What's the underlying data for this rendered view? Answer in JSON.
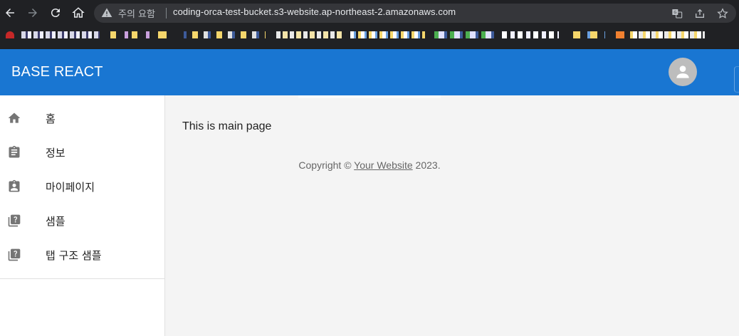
{
  "browser": {
    "security_label": "주의 요함",
    "url": "coding-orca-test-bucket.s3-website.ap-northeast-2.amazonaws.com",
    "icons": [
      "back-icon",
      "forward-icon",
      "reload-icon",
      "home-icon",
      "warning-icon",
      "translate-icon",
      "share-icon",
      "bookmark-star-icon"
    ]
  },
  "bookmarks_bar": {
    "note": ""
  },
  "appbar": {
    "title": "BASE REACT",
    "avatar_icon": "person-icon",
    "color": "#1976d2"
  },
  "drawer": {
    "items": [
      {
        "label": "홈",
        "icon": "home-icon"
      },
      {
        "label": "정보",
        "icon": "clipboard-icon"
      },
      {
        "label": "마이페이지",
        "icon": "assignment-ind-icon"
      },
      {
        "label": "샘플",
        "icon": "help-library-icon"
      },
      {
        "label": "탭 구조 샘플",
        "icon": "help-library-icon"
      }
    ]
  },
  "main": {
    "text": "This is main page",
    "copyright_prefix": "Copyright © ",
    "copyright_link": "Your Website",
    "copyright_suffix": " 2023."
  }
}
